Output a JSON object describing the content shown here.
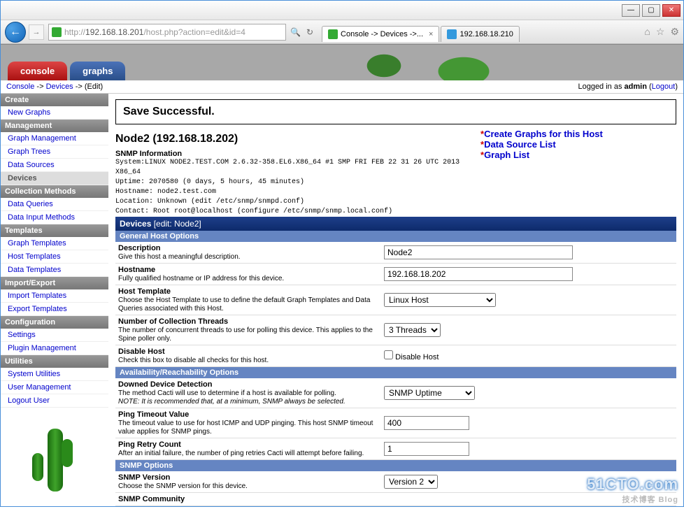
{
  "browser": {
    "url_host": "192.168.18.201",
    "url_path": "/host.php?action=edit&id=4",
    "tab1": "Console -> Devices ->...",
    "tab2": "192.168.18.210"
  },
  "nav": {
    "console": "console",
    "graphs": "graphs"
  },
  "breadcrumb": {
    "console": "Console",
    "arrow1": " -> ",
    "devices": "Devices",
    "arrow2": " -> (Edit)",
    "logged": "Logged in as ",
    "user": "admin",
    "paren1": " (",
    "logout": "Logout",
    "paren2": ")"
  },
  "sidebar": {
    "create": "Create",
    "new_graphs": "New Graphs",
    "management": "Management",
    "graph_mgmt": "Graph Management",
    "graph_trees": "Graph Trees",
    "data_sources": "Data Sources",
    "devices": "Devices",
    "coll_methods": "Collection Methods",
    "data_queries": "Data Queries",
    "data_input": "Data Input Methods",
    "templates": "Templates",
    "graph_tpl": "Graph Templates",
    "host_tpl": "Host Templates",
    "data_tpl": "Data Templates",
    "import_export": "Import/Export",
    "import_tpl": "Import Templates",
    "export_tpl": "Export Templates",
    "configuration": "Configuration",
    "settings": "Settings",
    "plugin_mgmt": "Plugin Management",
    "utilities": "Utilities",
    "sys_util": "System Utilities",
    "user_mgmt": "User Management",
    "logout_user": "Logout User"
  },
  "content": {
    "save_msg": "Save Successful.",
    "host_title": "Node2 (192.168.18.202)",
    "snmp_title": "SNMP Information",
    "snmp_system": "System:LINUX NODE2.TEST.COM 2.6.32-358.EL6.X86_64 #1 SMP FRI FEB 22 31 26 UTC 2013 X86_64",
    "snmp_uptime": "Uptime: 2070580 (0 days, 5 hours, 45 minutes)",
    "snmp_hostname": "Hostname: node2.test.com",
    "snmp_location": "Location: Unknown (edit /etc/snmp/snmpd.conf)",
    "snmp_contact": "Contact: Root root@localhost (configure /etc/snmp/snmp.local.conf)",
    "link1": "Create Graphs for this Host",
    "link2": "Data Source List",
    "link3": "Graph List",
    "devices_header": "Devices ",
    "devices_header_sub": "[edit: Node2]",
    "general_opts": "General Host Options",
    "desc_lbl": "Description",
    "desc_txt": "Give this host a meaningful description.",
    "desc_val": "Node2",
    "host_lbl": "Hostname",
    "host_txt": "Fully qualified hostname or IP address for this device.",
    "host_val": "192.168.18.202",
    "tpl_lbl": "Host Template",
    "tpl_txt": "Choose the Host Template to use to define the default Graph Templates and Data Queries associated with this Host.",
    "tpl_val": "Linux Host",
    "thr_lbl": "Number of Collection Threads",
    "thr_txt": "The number of concurrent threads to use for polling this device. This applies to the Spine poller only.",
    "thr_val": "3 Threads",
    "dis_lbl": "Disable Host",
    "dis_txt": "Check this box to disable all checks for this host.",
    "dis_chk": "Disable Host",
    "avail_opts": "Availability/Reachability Options",
    "down_lbl": "Downed Device Detection",
    "down_txt": "The method Cacti will use to determine if a host is available for polling.",
    "down_note": "NOTE: It is recommended that, at a minimum, SNMP always be selected.",
    "down_val": "SNMP Uptime",
    "ping_lbl": "Ping Timeout Value",
    "ping_txt": "The timeout value to use for host ICMP and UDP pinging. This host SNMP timeout value applies for SNMP pings.",
    "ping_val": "400",
    "retry_lbl": "Ping Retry Count",
    "retry_txt": "After an initial failure, the number of ping retries Cacti will attempt before failing.",
    "retry_val": "1",
    "snmp_opts": "SNMP Options",
    "ver_lbl": "SNMP Version",
    "ver_txt": "Choose the SNMP version for this device.",
    "ver_val": "Version 2",
    "comm_lbl": "SNMP Community"
  },
  "watermark": {
    "main": "51CTO.com",
    "sub": "技术博客  Blog"
  }
}
